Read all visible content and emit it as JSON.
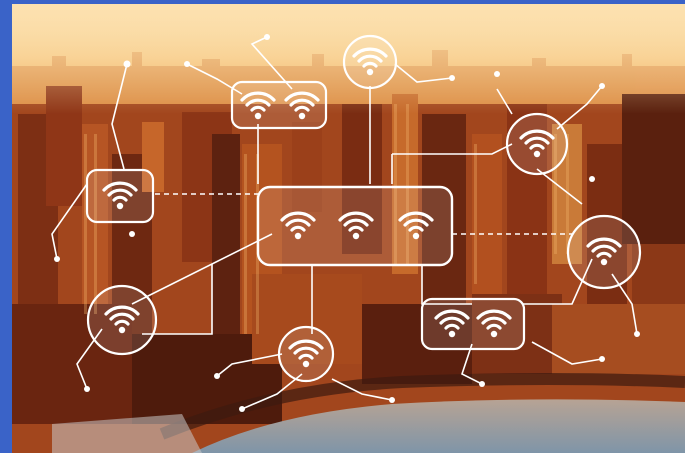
{
  "image": {
    "subject": "wifi-network-over-city",
    "colors": {
      "frame": "#3a63c8",
      "sky_top": "#f6d9a3",
      "sky_horizon": "#f3b86a",
      "city_dark": "#5a1f10",
      "city_mid": "#9a3b1a",
      "city_light": "#d97a2c",
      "water": "#8fa2b3",
      "overlay": "#ffffff"
    },
    "hubs": [
      {
        "id": "hub-top-double",
        "icon": "wifi-icon",
        "count": 2
      },
      {
        "id": "hub-top-circle",
        "icon": "wifi-icon",
        "count": 1
      },
      {
        "id": "hub-left",
        "icon": "wifi-icon",
        "count": 1
      },
      {
        "id": "hub-center",
        "icon": "wifi-icon",
        "count": 3
      },
      {
        "id": "hub-right-top",
        "icon": "wifi-icon",
        "count": 1
      },
      {
        "id": "hub-right-mid",
        "icon": "wifi-icon",
        "count": 1
      },
      {
        "id": "hub-left-low",
        "icon": "wifi-icon",
        "count": 1
      },
      {
        "id": "hub-bottom",
        "icon": "wifi-icon",
        "count": 1
      },
      {
        "id": "hub-bottom-right",
        "icon": "wifi-icon",
        "count": 2
      }
    ]
  }
}
